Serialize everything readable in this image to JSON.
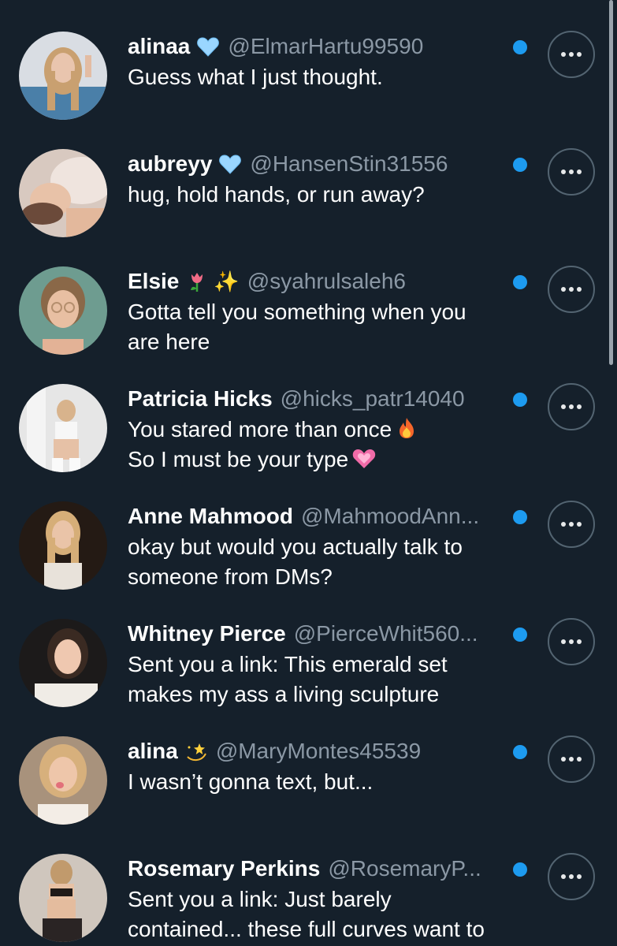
{
  "messages": [
    {
      "name": "alinaa",
      "badge": "light-blue-heart-icon",
      "handle": "@ElmarHartu99590",
      "lines": [
        "Guess what I just thought."
      ],
      "unread": true
    },
    {
      "name": "aubreyy",
      "badge": "light-blue-heart-icon",
      "handle": "@HansenStin31556",
      "lines": [
        "hug, hold hands, or run away?"
      ],
      "unread": true
    },
    {
      "name": "Elsie",
      "badge": "tulip-icon",
      "extra_badge": "sparkles-icon",
      "handle": "@syahrulsaleh6",
      "lines": [
        "Gotta tell you something when you",
        "are here"
      ],
      "unread": true
    },
    {
      "name": "Patricia Hicks",
      "handle": "@hicks_patr14040",
      "lines": [
        "You stared more than once",
        "So I must be your type"
      ],
      "line_emojis": [
        "fire-icon",
        "sparkling-heart-icon"
      ],
      "unread": true
    },
    {
      "name": "Anne Mahmood",
      "handle": "@MahmoodAnn...",
      "lines": [
        "okay but would you actually talk to",
        "someone from DMs?"
      ],
      "unread": true
    },
    {
      "name": "Whitney Pierce",
      "handle": "@PierceWhit560...",
      "lines": [
        "Sent you a link: This emerald set",
        "makes my ass a living sculpture"
      ],
      "unread": true
    },
    {
      "name": "alina",
      "badge": "dizzy-star-icon",
      "handle": "@MaryMontes45539",
      "lines": [
        "I wasn’t gonna text, but..."
      ],
      "unread": true
    },
    {
      "name": "Rosemary Perkins",
      "handle": "@RosemaryP...",
      "lines": [
        "Sent you a link: Just barely",
        "contained... these full curves want to"
      ],
      "unread": true
    }
  ],
  "colors": {
    "background": "#15202b",
    "text": "#ffffff",
    "handle": "#8b98a5",
    "unread_dot": "#1d9bf0",
    "button_border": "#536471"
  }
}
